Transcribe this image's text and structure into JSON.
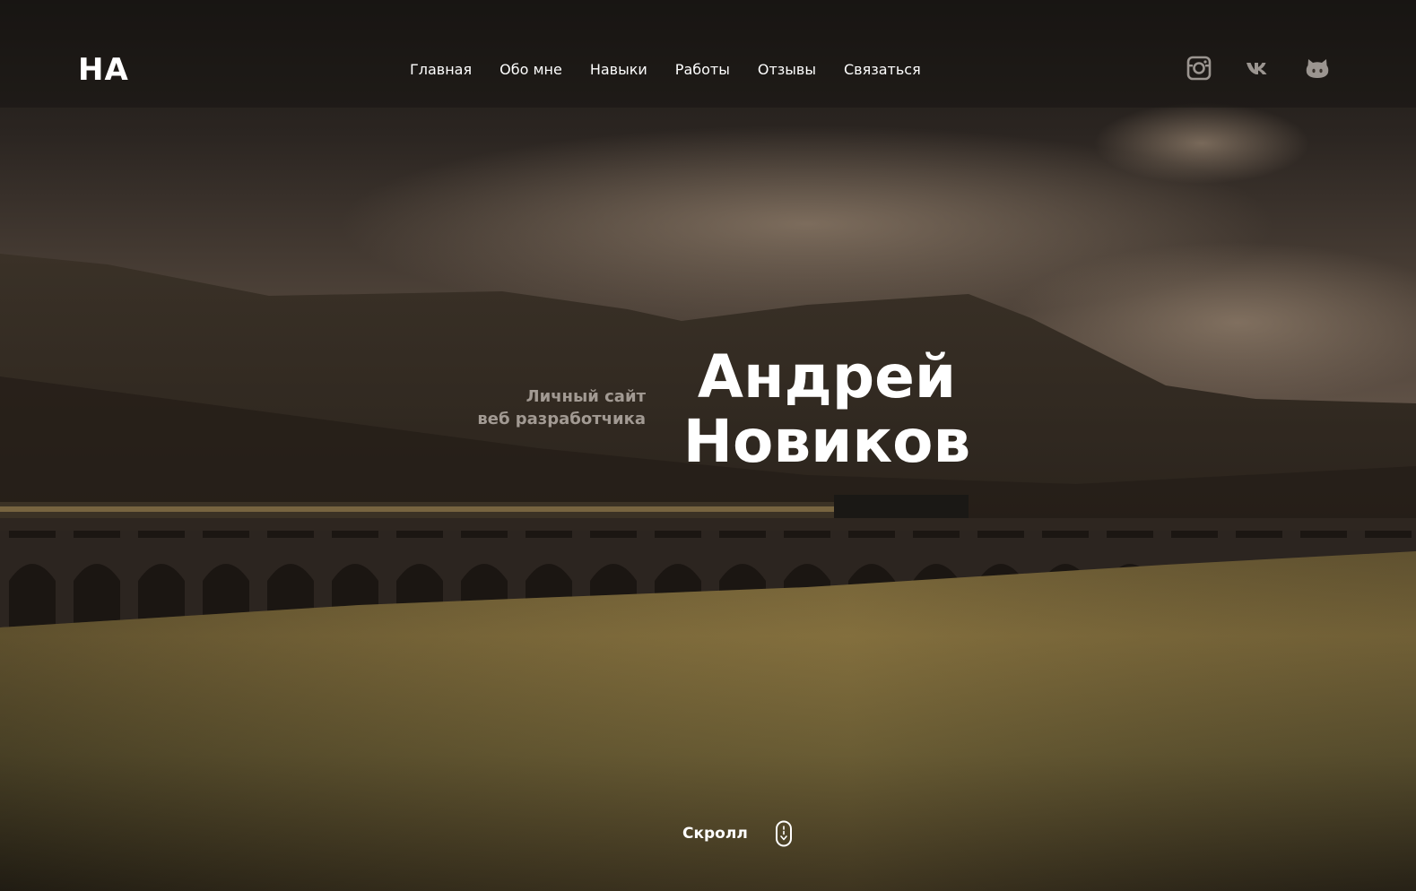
{
  "logo": "НА",
  "nav": [
    {
      "label": "Главная"
    },
    {
      "label": "Обо мне"
    },
    {
      "label": "Навыки"
    },
    {
      "label": "Работы"
    },
    {
      "label": "Отзывы"
    },
    {
      "label": "Связаться"
    }
  ],
  "social": [
    {
      "icon": "instagram-icon"
    },
    {
      "icon": "vk-icon"
    },
    {
      "icon": "github-icon"
    }
  ],
  "hero": {
    "subtitle_line1": "Личный сайт",
    "subtitle_line2": "веб разработчика",
    "first_name": "Андрей",
    "last_name": "Новиков"
  },
  "scroll": {
    "label": "Скролл",
    "icon": "mouse-scroll-icon"
  },
  "colors": {
    "text": "#ffffff",
    "subtitle": "#a29a93",
    "icon": "#9b9590"
  }
}
